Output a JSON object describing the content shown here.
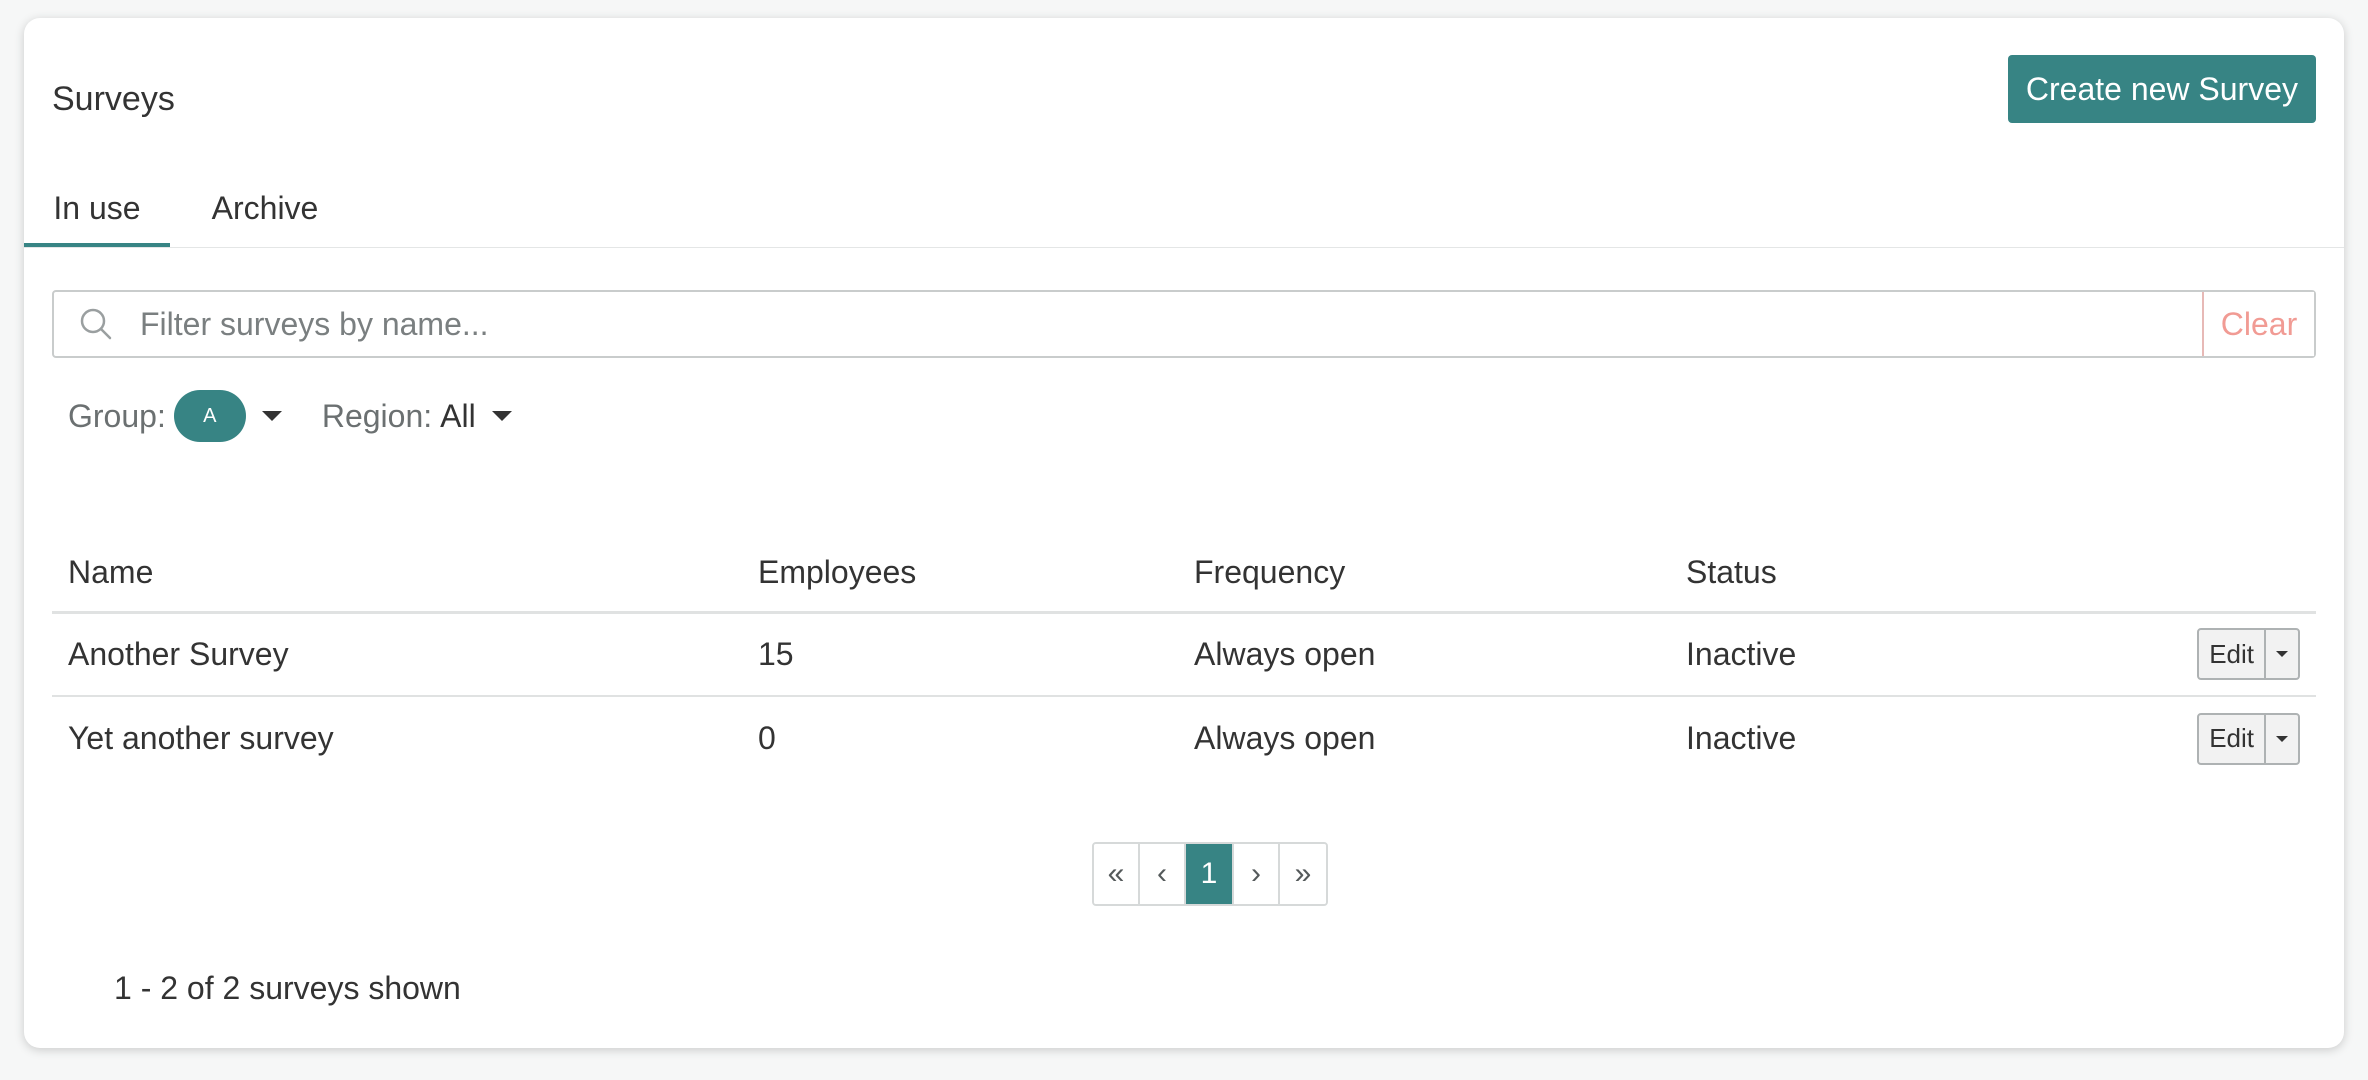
{
  "header": {
    "title": "Surveys",
    "create_button_label": "Create new Survey"
  },
  "tabs": [
    {
      "label": "In use",
      "active": true
    },
    {
      "label": "Archive",
      "active": false
    }
  ],
  "search": {
    "placeholder": "Filter surveys by name...",
    "value": "",
    "clear_label": "Clear",
    "icon": "search-icon"
  },
  "filters": {
    "group_label": "Group:",
    "group_value": "A",
    "region_label": "Region:",
    "region_value": "All"
  },
  "table": {
    "columns": [
      "Name",
      "Employees",
      "Frequency",
      "Status"
    ],
    "rows": [
      {
        "name": "Another Survey",
        "employees": "15",
        "frequency": "Always open",
        "status": "Inactive",
        "action_label": "Edit"
      },
      {
        "name": "Yet another survey",
        "employees": "0",
        "frequency": "Always open",
        "status": "Inactive",
        "action_label": "Edit"
      }
    ]
  },
  "pagination": {
    "first": "«",
    "prev": "‹",
    "current": "1",
    "next": "›",
    "last": "»"
  },
  "summary": {
    "count_text": "1 - 2 of 2 surveys shown"
  },
  "colors": {
    "accent": "#378484",
    "clear": "#f19b94"
  }
}
